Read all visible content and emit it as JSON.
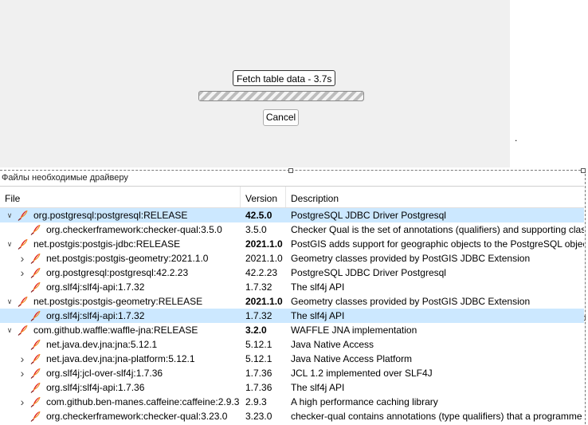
{
  "progress": {
    "status": "Fetch table data - 3.7s",
    "value_percent": 100,
    "cancel_label": "Cancel"
  },
  "dot": ".",
  "group_title": "Файлы необходимые драйверу",
  "columns": [
    "File",
    "Version",
    "Description"
  ],
  "colors": {
    "selected_row": "#cce8ff",
    "feather": "#e0201b"
  },
  "rows": [
    {
      "depth": 0,
      "expander": "open",
      "name": "org.postgresql:postgresql:RELEASE",
      "version": "42.5.0",
      "desc": "PostgreSQL JDBC Driver Postgresql",
      "bold": true,
      "selected": true
    },
    {
      "depth": 1,
      "expander": "none",
      "name": "org.checkerframework:checker-qual:3.5.0",
      "version": "3.5.0",
      "desc": "Checker Qual is the set of annotations (qualifiers) and supporting clas",
      "bold": false,
      "selected": false
    },
    {
      "depth": 0,
      "expander": "open",
      "name": "net.postgis:postgis-jdbc:RELEASE",
      "version": "2021.1.0",
      "desc": "PostGIS adds support for geographic objects to the PostgreSQL object",
      "bold": true,
      "selected": false
    },
    {
      "depth": 1,
      "expander": "closed",
      "name": "net.postgis:postgis-geometry:2021.1.0",
      "version": "2021.1.0",
      "desc": "Geometry classes provided by PostGIS JDBC Extension",
      "bold": false,
      "selected": false
    },
    {
      "depth": 1,
      "expander": "closed",
      "name": "org.postgresql:postgresql:42.2.23",
      "version": "42.2.23",
      "desc": "PostgreSQL JDBC Driver Postgresql",
      "bold": false,
      "selected": false
    },
    {
      "depth": 1,
      "expander": "none",
      "name": "org.slf4j:slf4j-api:1.7.32",
      "version": "1.7.32",
      "desc": "The slf4j API",
      "bold": false,
      "selected": false
    },
    {
      "depth": 0,
      "expander": "open",
      "name": "net.postgis:postgis-geometry:RELEASE",
      "version": "2021.1.0",
      "desc": "Geometry classes provided by PostGIS JDBC Extension",
      "bold": true,
      "selected": false
    },
    {
      "depth": 1,
      "expander": "none",
      "name": "org.slf4j:slf4j-api:1.7.32",
      "version": "1.7.32",
      "desc": "The slf4j API",
      "bold": false,
      "selected": true
    },
    {
      "depth": 0,
      "expander": "open",
      "name": "com.github.waffle:waffle-jna:RELEASE",
      "version": "3.2.0",
      "desc": "WAFFLE JNA implementation",
      "bold": true,
      "selected": false
    },
    {
      "depth": 1,
      "expander": "none",
      "name": "net.java.dev.jna:jna:5.12.1",
      "version": "5.12.1",
      "desc": "Java Native Access",
      "bold": false,
      "selected": false
    },
    {
      "depth": 1,
      "expander": "closed",
      "name": "net.java.dev.jna:jna-platform:5.12.1",
      "version": "5.12.1",
      "desc": "Java Native Access Platform",
      "bold": false,
      "selected": false
    },
    {
      "depth": 1,
      "expander": "closed",
      "name": "org.slf4j:jcl-over-slf4j:1.7.36",
      "version": "1.7.36",
      "desc": "JCL 1.2 implemented over SLF4J",
      "bold": false,
      "selected": false
    },
    {
      "depth": 1,
      "expander": "none",
      "name": "org.slf4j:slf4j-api:1.7.36",
      "version": "1.7.36",
      "desc": "The slf4j API",
      "bold": false,
      "selected": false
    },
    {
      "depth": 1,
      "expander": "closed",
      "name": "com.github.ben-manes.caffeine:caffeine:2.9.3",
      "version": "2.9.3",
      "desc": "A high performance caching library",
      "bold": false,
      "selected": false
    },
    {
      "depth": 1,
      "expander": "none",
      "name": "org.checkerframework:checker-qual:3.23.0",
      "version": "3.23.0",
      "desc": "checker-qual contains annotations (type qualifiers) that a programme",
      "bold": false,
      "selected": false
    }
  ]
}
